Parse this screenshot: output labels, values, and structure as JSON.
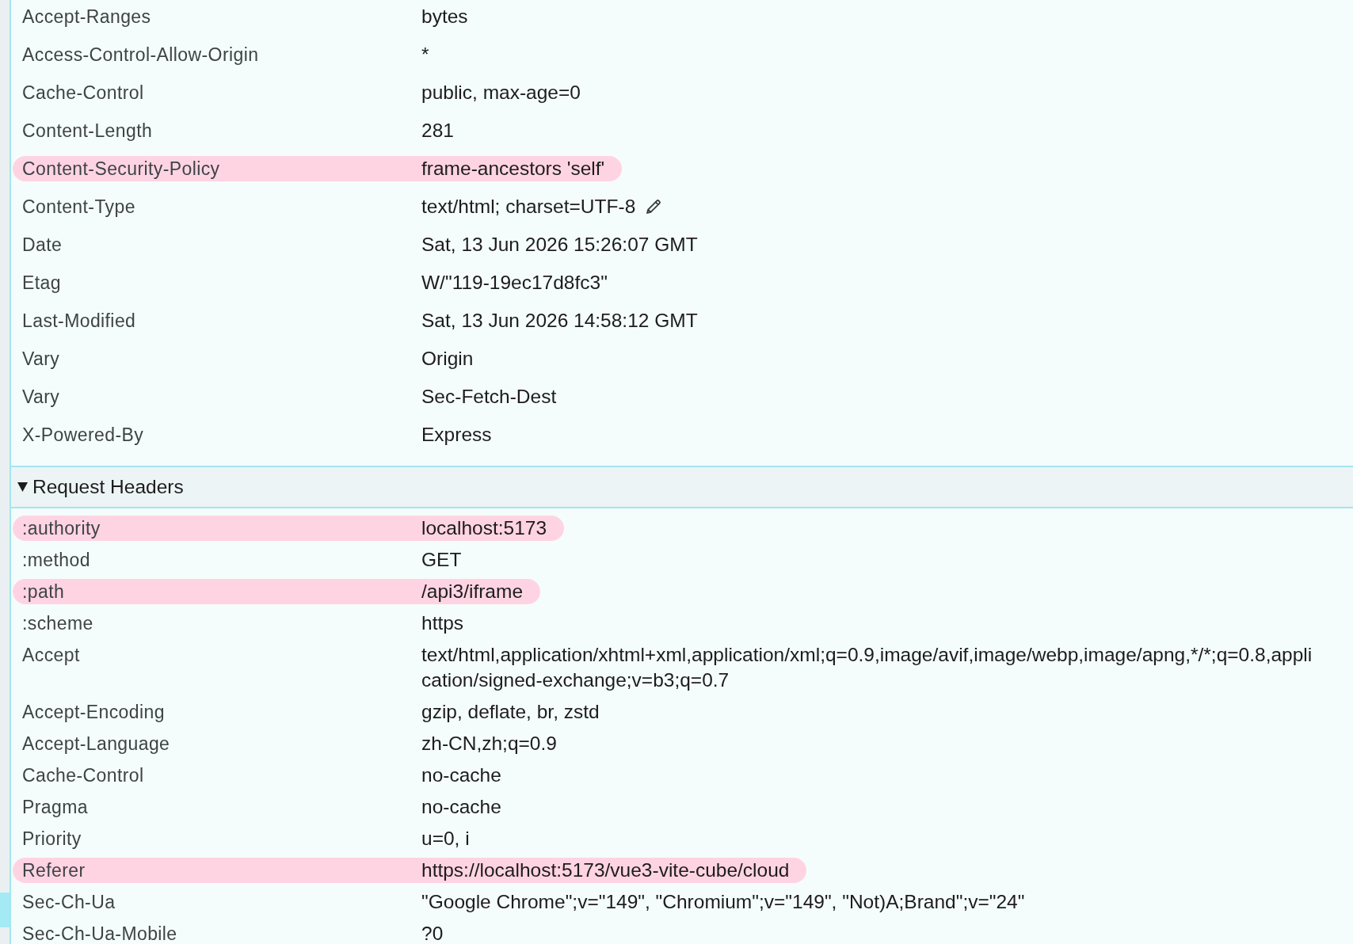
{
  "response_headers": {
    "rows": [
      {
        "name": "Accept-Ranges",
        "value": "bytes",
        "highlighted": false,
        "editable": false
      },
      {
        "name": "Access-Control-Allow-Origin",
        "value": "*",
        "highlighted": false,
        "editable": false
      },
      {
        "name": "Cache-Control",
        "value": "public, max-age=0",
        "highlighted": false,
        "editable": false
      },
      {
        "name": "Content-Length",
        "value": "281",
        "highlighted": false,
        "editable": false
      },
      {
        "name": "Content-Security-Policy",
        "value": "frame-ancestors 'self'",
        "highlighted": true,
        "editable": false
      },
      {
        "name": "Content-Type",
        "value": "text/html; charset=UTF-8",
        "highlighted": false,
        "editable": true
      },
      {
        "name": "Date",
        "value": "Sat, 13 Jun 2026 15:26:07 GMT",
        "highlighted": false,
        "editable": false
      },
      {
        "name": "Etag",
        "value": "W/\"119-19ec17d8fc3\"",
        "highlighted": false,
        "editable": false
      },
      {
        "name": "Last-Modified",
        "value": "Sat, 13 Jun 2026 14:58:12 GMT",
        "highlighted": false,
        "editable": false
      },
      {
        "name": "Vary",
        "value": "Origin",
        "highlighted": false,
        "editable": false
      },
      {
        "name": "Vary",
        "value": "Sec-Fetch-Dest",
        "highlighted": false,
        "editable": false
      },
      {
        "name": "X-Powered-By",
        "value": "Express",
        "highlighted": false,
        "editable": false
      }
    ]
  },
  "request_headers": {
    "title": "Request Headers",
    "expanded": true,
    "rows": [
      {
        "name": ":authority",
        "value": "localhost:5173",
        "highlighted": true
      },
      {
        "name": ":method",
        "value": "GET",
        "highlighted": false
      },
      {
        "name": ":path",
        "value": "/api3/iframe",
        "highlighted": true
      },
      {
        "name": ":scheme",
        "value": "https",
        "highlighted": false
      },
      {
        "name": "Accept",
        "value": "text/html,application/xhtml+xml,application/xml;q=0.9,image/avif,image/webp,image/apng,*/*;q=0.8,appli\ncation/signed-exchange;v=b3;q=0.7",
        "highlighted": false
      },
      {
        "name": "Accept-Encoding",
        "value": "gzip, deflate, br, zstd",
        "highlighted": false
      },
      {
        "name": "Accept-Language",
        "value": "zh-CN,zh;q=0.9",
        "highlighted": false
      },
      {
        "name": "Cache-Control",
        "value": "no-cache",
        "highlighted": false
      },
      {
        "name": "Pragma",
        "value": "no-cache",
        "highlighted": false
      },
      {
        "name": "Priority",
        "value": "u=0, i",
        "highlighted": false
      },
      {
        "name": "Referer",
        "value": "https://localhost:5173/vue3-vite-cube/cloud",
        "highlighted": true
      },
      {
        "name": "Sec-Ch-Ua",
        "value": "\"Google Chrome\";v=\"149\", \"Chromium\";v=\"149\", \"Not)A;Brand\";v=\"24\"",
        "highlighted": false
      },
      {
        "name": "Sec-Ch-Ua-Mobile",
        "value": "?0",
        "highlighted": false
      }
    ]
  }
}
